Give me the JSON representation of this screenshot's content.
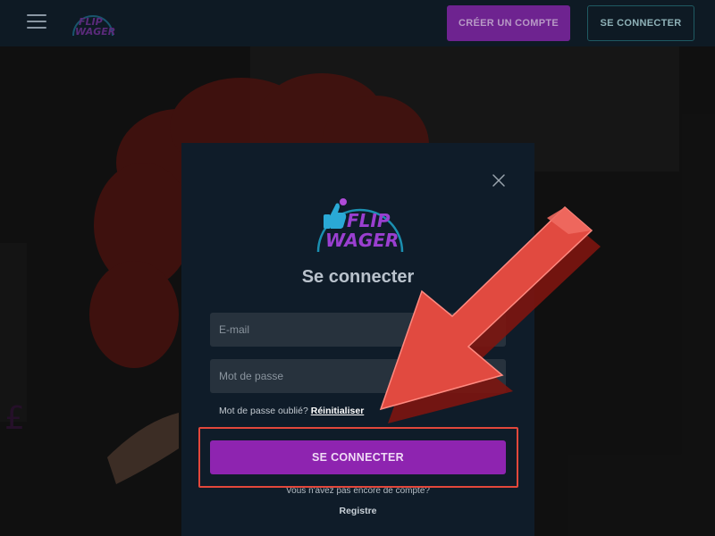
{
  "header": {
    "create_account_label": "CRÉER UN COMPTE",
    "login_label": "SE CONNECTER"
  },
  "modal": {
    "title": "Se connecter",
    "email_placeholder": "E-mail",
    "password_placeholder": "Mot de passe",
    "forgot_text": "Mot de passe oublié?",
    "reset_link": "Réinitialiser",
    "submit_label": "SE CONNECTER",
    "no_account_text": "Vous n'avez pas encore de compte?",
    "register_link": "Registre"
  },
  "icons": {
    "menu": "hamburger-menu-icon",
    "close": "close-icon",
    "eye": "eye-icon",
    "annotation": "red-arrow-annotation"
  },
  "colors": {
    "accent": "#8e24b0",
    "header_bg": "#0e1a24",
    "modal_bg": "#0f1c29",
    "annotation": "#e2473b"
  }
}
